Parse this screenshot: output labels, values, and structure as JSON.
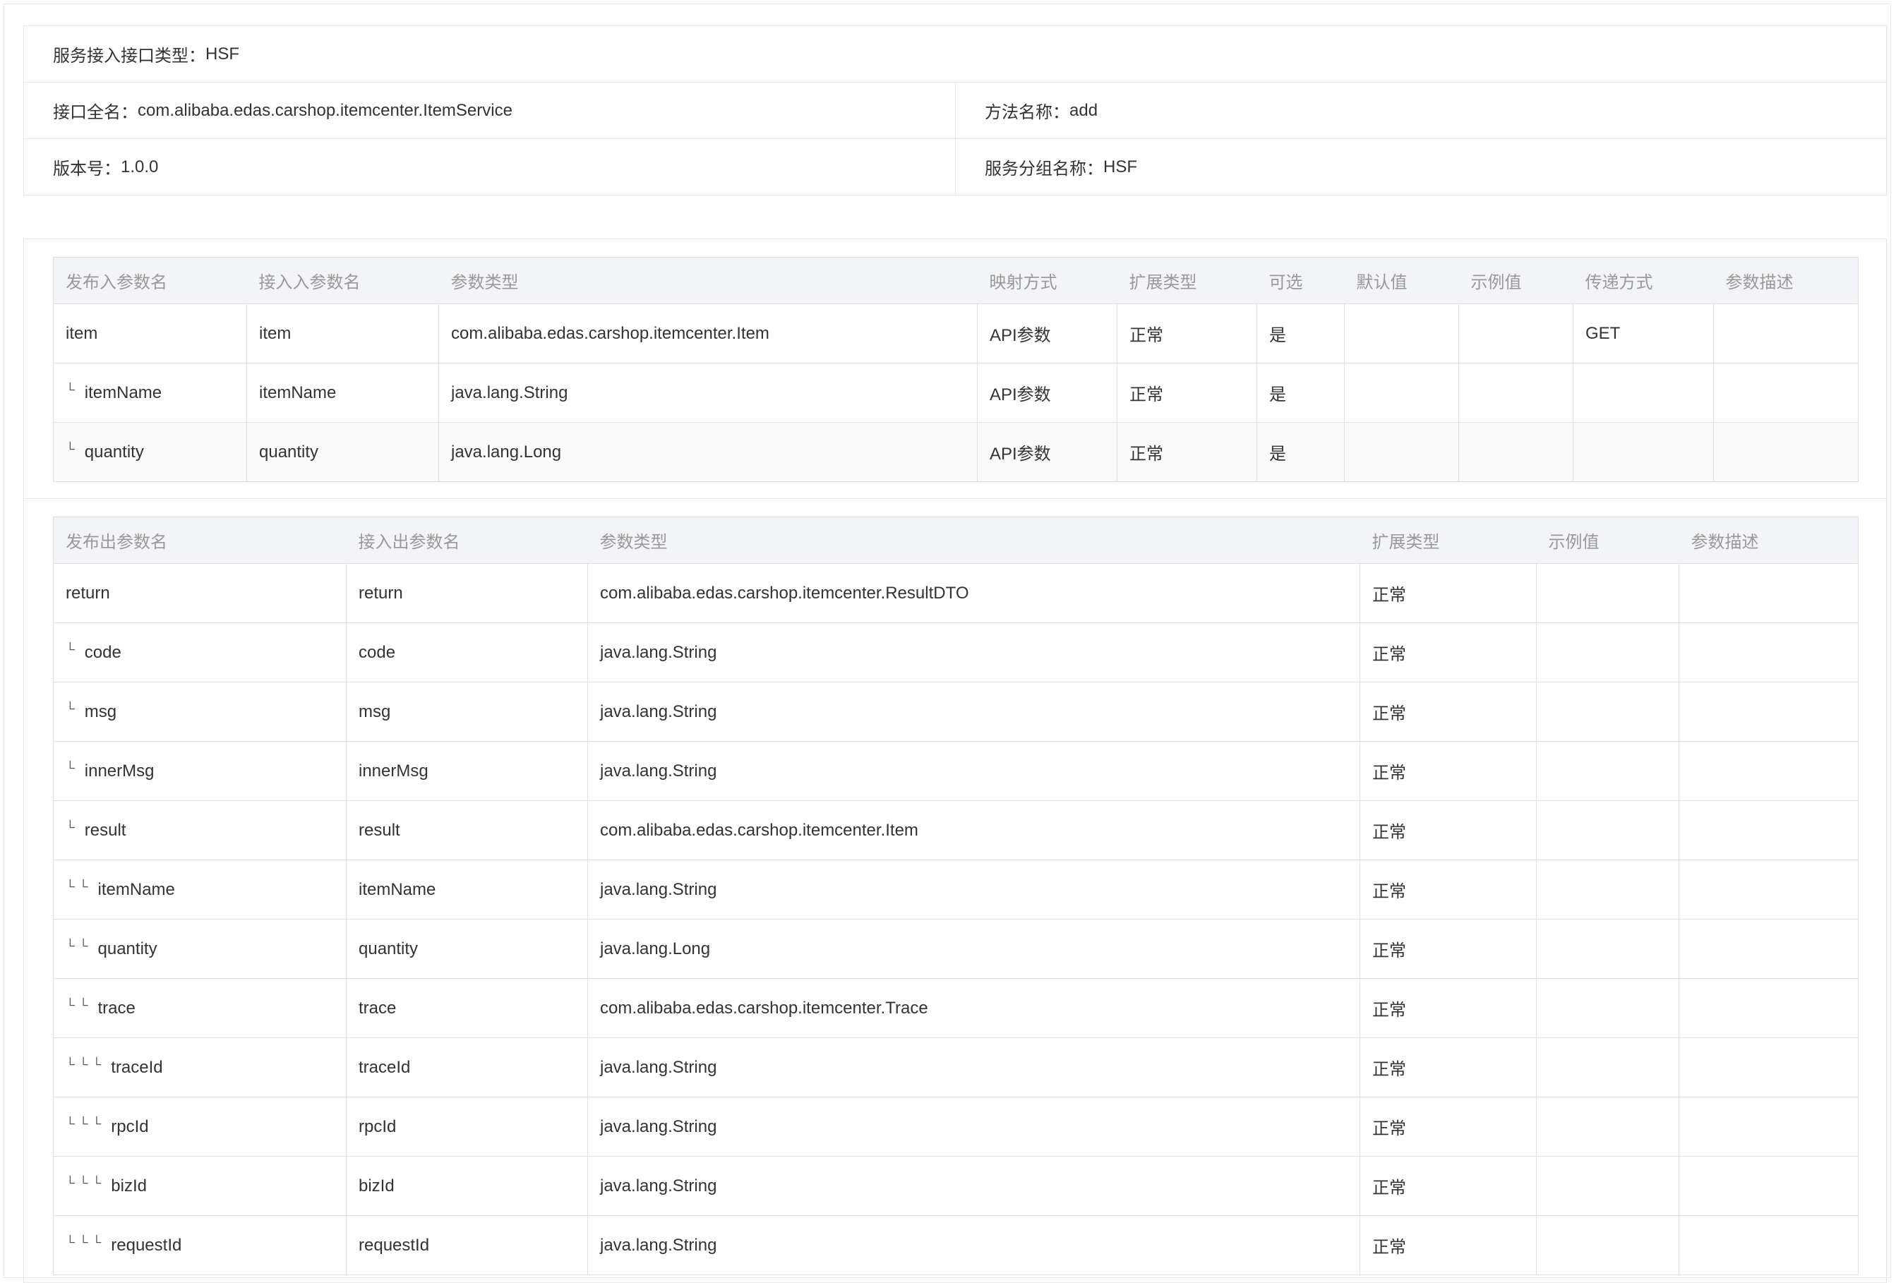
{
  "service_info": {
    "interface_type": {
      "label": "服务接入接口类型：",
      "value": "HSF"
    },
    "interface_name": {
      "label": "接口全名：",
      "value": "com.alibaba.edas.carshop.itemcenter.ItemService"
    },
    "method_name": {
      "label": "方法名称：",
      "value": "add"
    },
    "version": {
      "label": "版本号：",
      "value": "1.0.0"
    },
    "group_name": {
      "label": "服务分组名称：",
      "value": "HSF"
    }
  },
  "input_params": {
    "headers": [
      "发布入参数名",
      "接入入参数名",
      "参数类型",
      "映射方式",
      "扩展类型",
      "可选",
      "默认值",
      "示例值",
      "传递方式",
      "参数描述"
    ],
    "rows": [
      {
        "indent": "",
        "publish_name": "item",
        "access_name": "item",
        "type": "com.alibaba.edas.carshop.itemcenter.Item",
        "mapping": "API参数",
        "ext_type": "正常",
        "optional": "是",
        "default": "",
        "example": "",
        "transfer": "GET",
        "desc": ""
      },
      {
        "indent": "└",
        "publish_name": "itemName",
        "access_name": "itemName",
        "type": "java.lang.String",
        "mapping": "API参数",
        "ext_type": "正常",
        "optional": "是",
        "default": "",
        "example": "",
        "transfer": "",
        "desc": ""
      },
      {
        "indent": "└",
        "publish_name": "quantity",
        "access_name": "quantity",
        "type": "java.lang.Long",
        "mapping": "API参数",
        "ext_type": "正常",
        "optional": "是",
        "default": "",
        "example": "",
        "transfer": "",
        "desc": ""
      }
    ]
  },
  "output_params": {
    "headers": [
      "发布出参数名",
      "接入出参数名",
      "参数类型",
      "扩展类型",
      "示例值",
      "参数描述"
    ],
    "rows": [
      {
        "indent": "",
        "publish_name": "return",
        "access_name": "return",
        "type": "com.alibaba.edas.carshop.itemcenter.ResultDTO",
        "ext_type": "正常",
        "example": "",
        "desc": ""
      },
      {
        "indent": "└",
        "publish_name": "code",
        "access_name": "code",
        "type": "java.lang.String",
        "ext_type": "正常",
        "example": "",
        "desc": ""
      },
      {
        "indent": "└",
        "publish_name": "msg",
        "access_name": "msg",
        "type": "java.lang.String",
        "ext_type": "正常",
        "example": "",
        "desc": ""
      },
      {
        "indent": "└",
        "publish_name": "innerMsg",
        "access_name": "innerMsg",
        "type": "java.lang.String",
        "ext_type": "正常",
        "example": "",
        "desc": ""
      },
      {
        "indent": "└",
        "publish_name": "result",
        "access_name": "result",
        "type": "com.alibaba.edas.carshop.itemcenter.Item",
        "ext_type": "正常",
        "example": "",
        "desc": ""
      },
      {
        "indent": "└└",
        "publish_name": "itemName",
        "access_name": "itemName",
        "type": "java.lang.String",
        "ext_type": "正常",
        "example": "",
        "desc": ""
      },
      {
        "indent": "└└",
        "publish_name": "quantity",
        "access_name": "quantity",
        "type": "java.lang.Long",
        "ext_type": "正常",
        "example": "",
        "desc": ""
      },
      {
        "indent": "└└",
        "publish_name": "trace",
        "access_name": "trace",
        "type": "com.alibaba.edas.carshop.itemcenter.Trace",
        "ext_type": "正常",
        "example": "",
        "desc": ""
      },
      {
        "indent": "└└└",
        "publish_name": "traceId",
        "access_name": "traceId",
        "type": "java.lang.String",
        "ext_type": "正常",
        "example": "",
        "desc": ""
      },
      {
        "indent": "└└└",
        "publish_name": "rpcId",
        "access_name": "rpcId",
        "type": "java.lang.String",
        "ext_type": "正常",
        "example": "",
        "desc": ""
      },
      {
        "indent": "└└└",
        "publish_name": "bizId",
        "access_name": "bizId",
        "type": "java.lang.String",
        "ext_type": "正常",
        "example": "",
        "desc": ""
      },
      {
        "indent": "└└└",
        "publish_name": "requestId",
        "access_name": "requestId",
        "type": "java.lang.String",
        "ext_type": "正常",
        "example": "",
        "desc": ""
      }
    ]
  }
}
